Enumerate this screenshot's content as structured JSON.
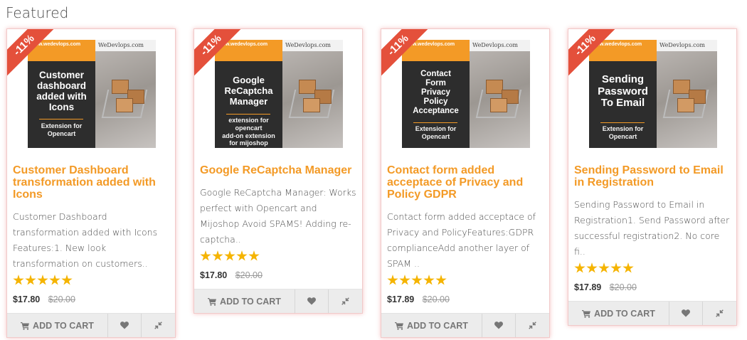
{
  "section": {
    "title": "Featured"
  },
  "products": [
    {
      "badge": "-11%",
      "image": {
        "url_text": "www.wedevlops.com",
        "brand_text": "WeDevlops.com",
        "title_lines": [
          "Customer",
          "dashboard",
          "added with",
          "Icons"
        ],
        "ext_lines": [
          "Extension for",
          "Opencart"
        ]
      },
      "name": "Customer Dashboard transformation added with Icons",
      "description": "Customer Dashboard transformation added with Icons Features:1. New look transformation on customers..",
      "rating": 5,
      "price_new": "$17.80",
      "price_old": "$20.00",
      "add_to_cart": "ADD TO CART"
    },
    {
      "badge": "-11%",
      "image": {
        "url_text": "www.wedevlops.com",
        "brand_text": "WeDevlops.com",
        "title_lines": [
          "Google",
          "ReCaptcha",
          "Manager"
        ],
        "ext_lines": [
          "extension for opencart",
          "add-on extension for mijoshop"
        ]
      },
      "name": "Google ReCaptcha Manager",
      "description": "Google ReCaptcha Manager: Works perfect with Opencart and Mijoshop Avoid SPAMS! Adding re-captcha..",
      "rating": 5,
      "price_new": "$17.80",
      "price_old": "$20.00",
      "add_to_cart": "ADD TO CART"
    },
    {
      "badge": "-11%",
      "image": {
        "url_text": "www.wedevlops.com",
        "brand_text": "WeDevlops.com",
        "title_lines": [
          "Contact",
          "Form",
          "Privacy",
          "Policy",
          "Acceptance"
        ],
        "ext_lines": [
          "Extension for",
          "Opencart"
        ]
      },
      "name": "Contact form added acceptace of Privacy and Policy GDPR",
      "description": "Contact form added acceptace of Privacy and PolicyFeatures:GDPR complianceAdd another layer of SPAM ..",
      "rating": 5,
      "price_new": "$17.89",
      "price_old": "$20.00",
      "add_to_cart": "ADD TO CART"
    },
    {
      "badge": "-11%",
      "image": {
        "url_text": "www.wedevlops.com",
        "brand_text": "WeDevlops.com",
        "title_lines": [
          "Sending",
          "Password",
          "To Email"
        ],
        "ext_lines": [
          "Extension for",
          "Opencart"
        ]
      },
      "name": "Sending Password to Email in Registration",
      "description": "Sending Password to Email in Registration1. Send Password after successful registration2. No core fi..",
      "rating": 5,
      "price_new": "$17.89",
      "price_old": "$20.00",
      "add_to_cart": "ADD TO CART"
    }
  ],
  "colors": {
    "accent": "#f39a26",
    "badge": "#e4503b",
    "star": "#f5b400"
  },
  "icons": {
    "cart": "cart-icon",
    "wishlist": "heart-icon",
    "compare": "compare-icon"
  }
}
